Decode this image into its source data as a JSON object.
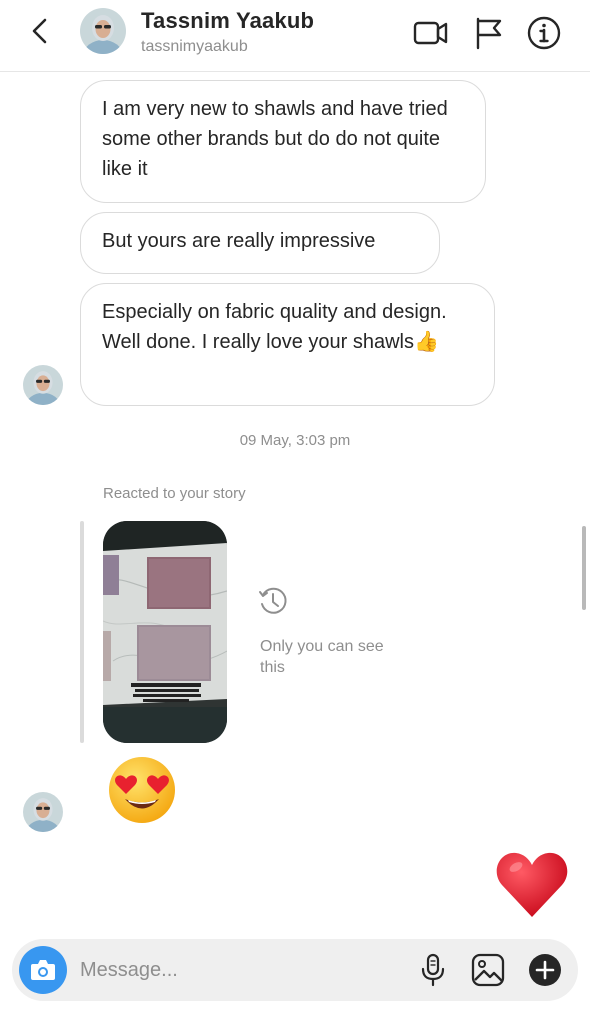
{
  "header": {
    "name": "Tassnim Yaakub",
    "handle": "tassnimyaakub",
    "icons": [
      "chevron-left-icon",
      "video-camera-icon",
      "flag-icon",
      "info-icon"
    ]
  },
  "messages": [
    {
      "text": "I am very new to shawls and have tried some other brands but do do not quite like it"
    },
    {
      "text": "But yours are really impressive"
    },
    {
      "text": "Especially on fabric quality and design. Well done. I really love your shawls",
      "emoji": "👍"
    }
  ],
  "timestamp": "09 May, 3:03 pm",
  "story_reaction": {
    "label": "Reacted to your story",
    "notice": "Only you can see this",
    "reaction_emoji": "😍"
  },
  "heart": "❤️",
  "composer": {
    "placeholder": "Message...",
    "value": "",
    "icons": [
      "camera-icon",
      "microphone-icon",
      "gallery-icon",
      "plus-icon"
    ]
  },
  "colors": {
    "accent": "#3897f0",
    "bubble_border": "#dbdbdb",
    "secondary_text": "#8e8e8e",
    "heart": "#e0162b"
  }
}
